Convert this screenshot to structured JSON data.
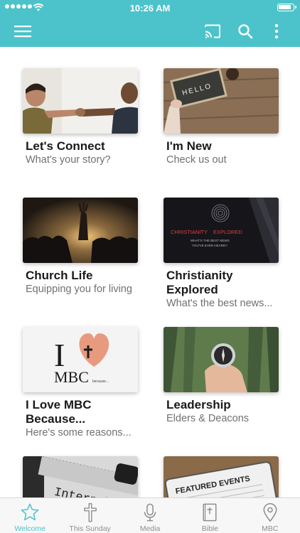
{
  "status_bar": {
    "time": "10:26 AM"
  },
  "colors": {
    "accent": "#4cc3ca",
    "title_text": "#1a1a1a",
    "subtitle_text": "#707070",
    "tab_inactive": "#8e8e8e"
  },
  "header": {
    "menu_icon": "hamburger-icon",
    "actions": [
      "cast-icon",
      "search-icon",
      "more-vertical-icon"
    ]
  },
  "cards": [
    {
      "title": "Let's Connect",
      "subtitle": "What's your story?"
    },
    {
      "title": "I'm New",
      "subtitle": "Check us out",
      "image_text": "HELLO"
    },
    {
      "title": "Church Life",
      "subtitle": "Equipping you for living"
    },
    {
      "title": "Christianity Explored",
      "subtitle": "What's the best news...",
      "image_text_1": "CHRISTIANITY",
      "image_text_2": "EXPLORED",
      "image_text_3": "WHAT'S THE BEST NEWS",
      "image_text_4": "YOU'VE EVER HEARD?"
    },
    {
      "title": "I Love MBC Because...",
      "subtitle": "Here's some reasons...",
      "image_text_1": "I",
      "image_text_2": "MBC",
      "image_text_3": "because..."
    },
    {
      "title": "Leadership",
      "subtitle": "Elders & Deacons"
    },
    {
      "title": "",
      "subtitle": "",
      "image_text": "Internship"
    },
    {
      "title": "",
      "subtitle": "",
      "image_text": "FEATURED EVENTS"
    }
  ],
  "tabs": [
    {
      "label": "Welcome",
      "icon": "star-icon",
      "active": true
    },
    {
      "label": "This Sunday",
      "icon": "cross-icon",
      "active": false
    },
    {
      "label": "Media",
      "icon": "microphone-icon",
      "active": false
    },
    {
      "label": "Bible",
      "icon": "bible-icon",
      "active": false
    },
    {
      "label": "MBC",
      "icon": "map-pin-icon",
      "active": false
    }
  ]
}
